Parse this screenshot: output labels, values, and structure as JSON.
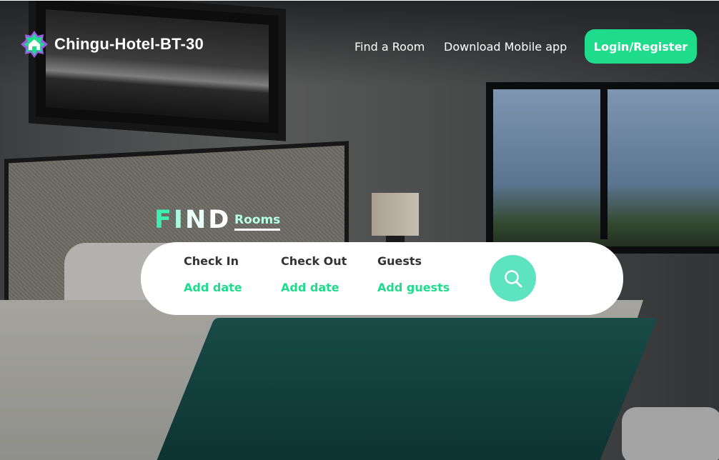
{
  "brand": {
    "name": "Chingu-Hotel-BT-30",
    "accent": "#1fdc8c",
    "logo_colors": [
      "#9b5de5",
      "#1fdc8c",
      "#f15bb5"
    ]
  },
  "nav": {
    "links": [
      "Find a Room",
      "Download Mobile app"
    ],
    "login_label": "Login/Register"
  },
  "hero": {
    "heading_letters": [
      "F",
      "I",
      "N",
      "D"
    ],
    "heading_colors": [
      "#3df0b0",
      "#a8f7e0",
      "#eafff8",
      "#ffffff"
    ],
    "tag": "Rooms"
  },
  "search": {
    "fields": [
      {
        "label": "Check In",
        "value": "Add date"
      },
      {
        "label": "Check Out",
        "value": "Add date"
      },
      {
        "label": "Guests",
        "value": "Add guests"
      }
    ],
    "button_icon": "search-icon"
  }
}
